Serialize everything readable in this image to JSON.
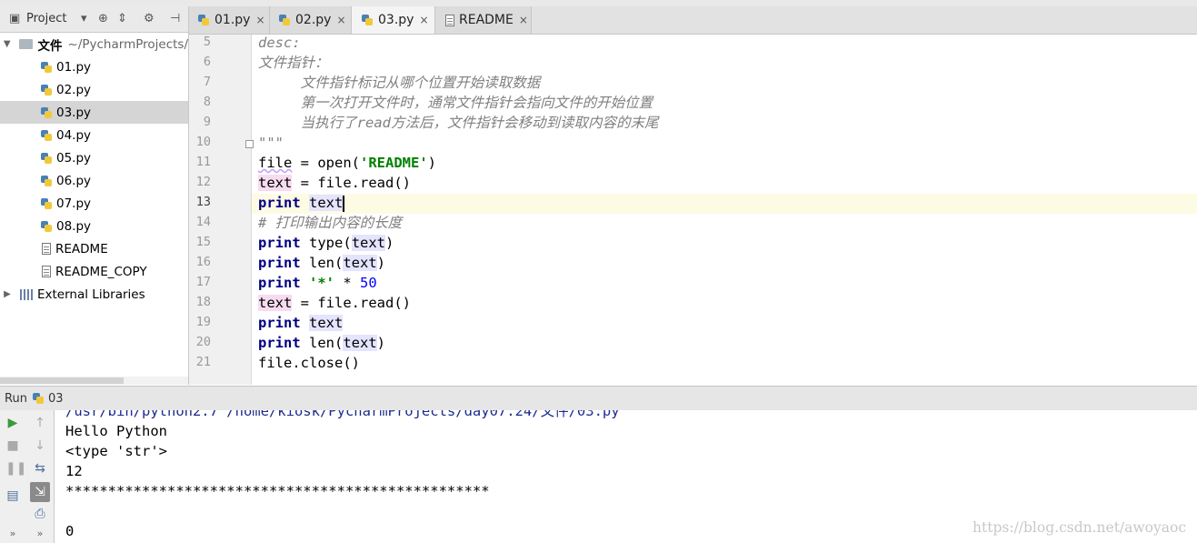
{
  "project_panel": {
    "title": "Project",
    "root_folder_name": "文件",
    "root_folder_path": "~/PycharmProjects/",
    "files": [
      "01.py",
      "02.py",
      "03.py",
      "04.py",
      "05.py",
      "06.py",
      "07.py",
      "08.py",
      "README",
      "README_COPY"
    ],
    "selected_file": "03.py",
    "external_libraries": "External Libraries"
  },
  "editor": {
    "tabs": [
      {
        "label": "01.py",
        "close": "×"
      },
      {
        "label": "02.py",
        "close": "×"
      },
      {
        "label": "03.py",
        "close": "×"
      },
      {
        "label": "README",
        "close": "×"
      }
    ],
    "active_tab": "03.py",
    "current_line": 13,
    "line_numbers": [
      "5",
      "6",
      "7",
      "8",
      "9",
      "10",
      "11",
      "12",
      "13",
      "14",
      "15",
      "16",
      "17",
      "18",
      "19",
      "20",
      "21"
    ],
    "code": {
      "l5": "desc:",
      "l6": "文件指针：",
      "l7": "     文件指针标记从哪个位置开始读取数据",
      "l8": "     第一次打开文件时，通常文件指针会指向文件的开始位置",
      "l9": "     当执行了read方法后，文件指针会移动到读取内容的末尾",
      "l10": "\"\"\"",
      "kw_print": "print",
      "var_file": "file",
      "var_text": "text",
      "eq": " = ",
      "open_fn": "open(",
      "readme_str": "'README'",
      "close_paren": ")",
      "read_call": "file.read()",
      "comment14": "# 打印输出内容的长度",
      "type_fn": "type(",
      "len_fn": "len(",
      "star_str": "'*'",
      "times": " * ",
      "fifty": "50",
      "close_call": "file.close()"
    }
  },
  "run_panel": {
    "title": "Run",
    "config_name": "03",
    "output": [
      "/usr/bin/python2.7 /home/kiosk/PycharmProjects/day07.24/文件/03.py",
      "Hello Python",
      "<type 'str'>",
      "12",
      "**************************************************",
      "",
      "0"
    ]
  },
  "watermark": "https://blog.csdn.net/awoyaoc",
  "colors": {
    "keyword": "#000080",
    "string": "#008000",
    "number": "#0000ff",
    "comment": "#808080",
    "run_green": "#3a9a3a",
    "selection": "#d5d5d5"
  }
}
